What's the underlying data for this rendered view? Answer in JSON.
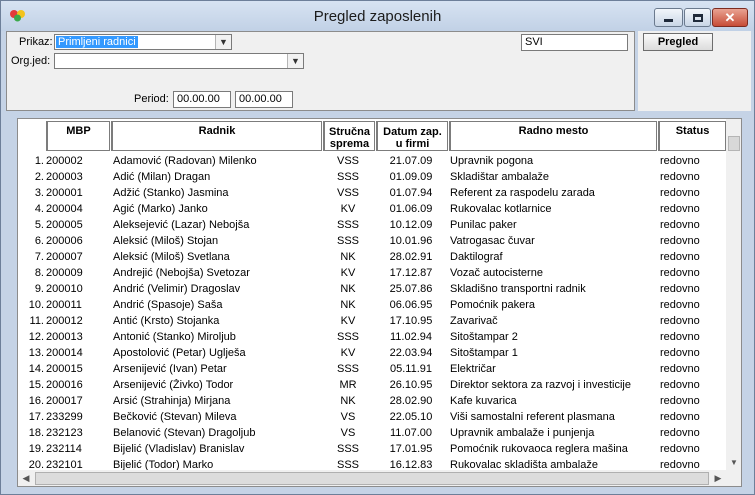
{
  "window": {
    "title": "Pregled zaposlenih"
  },
  "filters": {
    "prikaz_label": "Prikaz:",
    "prikaz_value": "Primljeni radnici",
    "orgjed_label": "Org.jed:",
    "orgjed_value": "",
    "svi_value": "SVI",
    "period_label": "Period:",
    "period_from": "00.00.00",
    "period_to": "00.00.00"
  },
  "actions": {
    "pregled_label": "Pregled"
  },
  "table": {
    "columns": {
      "mbp": "MBP",
      "radnik": "Radnik",
      "strucna_1": "Stručna",
      "strucna_2": "sprema",
      "datum_1": "Datum zap.",
      "datum_2": "u firmi",
      "mesto": "Radno mesto",
      "status": "Status"
    },
    "rows": [
      {
        "n": "1.",
        "mbp": "200002",
        "radnik": "Adamović (Radovan) Milenko",
        "sprema": "VSS",
        "datum": "21.07.09",
        "mesto": "Upravnik pogona",
        "status": "redovno"
      },
      {
        "n": "2.",
        "mbp": "200003",
        "radnik": "Adić (Milan) Dragan",
        "sprema": "SSS",
        "datum": "01.09.09",
        "mesto": "Skladištar ambalaže",
        "status": "redovno"
      },
      {
        "n": "3.",
        "mbp": "200001",
        "radnik": "Adžić (Stanko) Jasmina",
        "sprema": "VSS",
        "datum": "01.07.94",
        "mesto": "Referent za raspodelu zarada",
        "status": "redovno"
      },
      {
        "n": "4.",
        "mbp": "200004",
        "radnik": "Agić (Marko) Janko",
        "sprema": "KV",
        "datum": "01.06.09",
        "mesto": "Rukovalac kotlarnice",
        "status": "redovno"
      },
      {
        "n": "5.",
        "mbp": "200005",
        "radnik": "Aleksejević (Lazar) Nebojša",
        "sprema": "SSS",
        "datum": "10.12.09",
        "mesto": "Punilac paker",
        "status": "redovno"
      },
      {
        "n": "6.",
        "mbp": "200006",
        "radnik": "Aleksić (Miloš) Stojan",
        "sprema": "SSS",
        "datum": "10.01.96",
        "mesto": "Vatrogasac čuvar",
        "status": "redovno"
      },
      {
        "n": "7.",
        "mbp": "200007",
        "radnik": "Aleksić (Miloš) Svetlana",
        "sprema": "NK",
        "datum": "28.02.91",
        "mesto": "Daktilograf",
        "status": "redovno"
      },
      {
        "n": "8.",
        "mbp": "200009",
        "radnik": "Andrejić (Nebojša) Svetozar",
        "sprema": "KV",
        "datum": "17.12.87",
        "mesto": "Vozač autocisterne",
        "status": "redovno"
      },
      {
        "n": "9.",
        "mbp": "200010",
        "radnik": "Andrić (Velimir) Dragoslav",
        "sprema": "NK",
        "datum": "25.07.86",
        "mesto": "Skladišno transportni radnik",
        "status": "redovno"
      },
      {
        "n": "10.",
        "mbp": "200011",
        "radnik": "Andrić (Spasoje) Saša",
        "sprema": "NK",
        "datum": "06.06.95",
        "mesto": "Pomoćnik pakera",
        "status": "redovno"
      },
      {
        "n": "11.",
        "mbp": "200012",
        "radnik": "Antić (Krsto) Stojanka",
        "sprema": "KV",
        "datum": "17.10.95",
        "mesto": "Zavarivač",
        "status": "redovno"
      },
      {
        "n": "12.",
        "mbp": "200013",
        "radnik": "Antonić (Stanko) Miroljub",
        "sprema": "SSS",
        "datum": "11.02.94",
        "mesto": "Sitoštampar 2",
        "status": "redovno"
      },
      {
        "n": "13.",
        "mbp": "200014",
        "radnik": "Apostolović (Petar) Uglješa",
        "sprema": "KV",
        "datum": "22.03.94",
        "mesto": "Sitoštampar 1",
        "status": "redovno"
      },
      {
        "n": "14.",
        "mbp": "200015",
        "radnik": "Arsenijević (Ivan) Petar",
        "sprema": "SSS",
        "datum": "05.11.91",
        "mesto": "Električar",
        "status": "redovno"
      },
      {
        "n": "15.",
        "mbp": "200016",
        "radnik": "Arsenijević (Živko) Todor",
        "sprema": "MR",
        "datum": "26.10.95",
        "mesto": "Direktor sektora za razvoj i investicije",
        "status": "redovno"
      },
      {
        "n": "16.",
        "mbp": "200017",
        "radnik": "Arsić (Strahinja) Mirjana",
        "sprema": "NK",
        "datum": "28.02.90",
        "mesto": "Kafe kuvarica",
        "status": "redovno"
      },
      {
        "n": "17.",
        "mbp": "233299",
        "radnik": "Bečković (Stevan) Mileva",
        "sprema": "VS",
        "datum": "22.05.10",
        "mesto": "Viši samostalni referent plasmana",
        "status": "redovno"
      },
      {
        "n": "18.",
        "mbp": "232123",
        "radnik": "Belanović (Stevan) Dragoljub",
        "sprema": "VS",
        "datum": "11.07.00",
        "mesto": "Upravnik ambalaže i punjenja",
        "status": "redovno"
      },
      {
        "n": "19.",
        "mbp": "232114",
        "radnik": "Bijelić (Vladislav) Branislav",
        "sprema": "SSS",
        "datum": "17.01.95",
        "mesto": "Pomoćnik rukovaoca reglera mašina",
        "status": "redovno"
      },
      {
        "n": "20.",
        "mbp": "232101",
        "radnik": "Bijelić (Todor) Marko",
        "sprema": "SSS",
        "datum": "16.12.83",
        "mesto": "Rukovalac skladišta ambalaže",
        "status": "redovno"
      }
    ]
  }
}
